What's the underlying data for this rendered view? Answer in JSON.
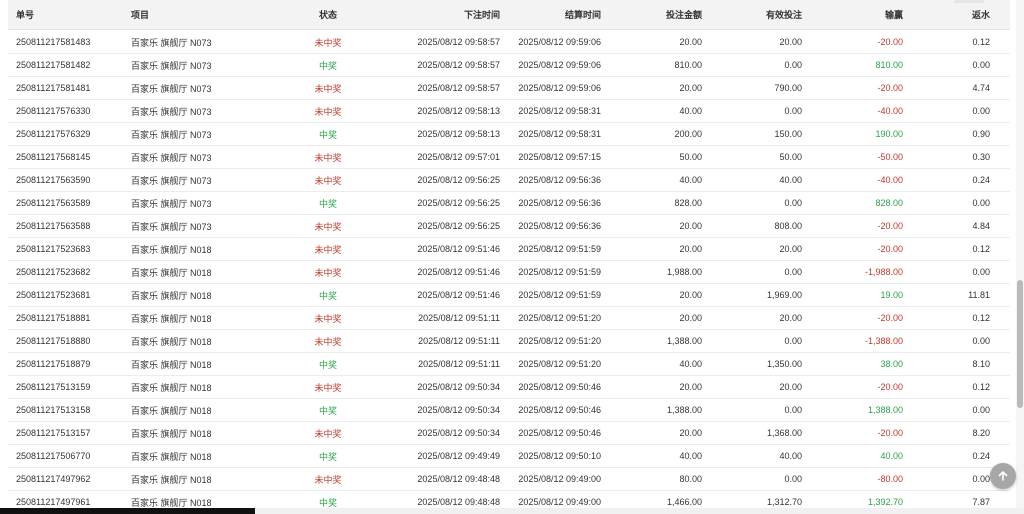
{
  "table": {
    "columns": {
      "id": "单号",
      "item": "项目",
      "status": "状态",
      "bet_time": "下注时间",
      "settle_time": "结算时间",
      "amount": "投注金额",
      "valid": "有效投注",
      "win_loss": "输赢",
      "rebate": "返水"
    },
    "rows": [
      {
        "id": "250811217581483",
        "item": "百家乐 旗舰厅 N073",
        "status": "未中奖",
        "status_type": "lose",
        "bet_time": "2025/08/12 09:58:57",
        "settle_time": "2025/08/12 09:59:06",
        "amount": "20.00",
        "valid": "20.00",
        "win_loss": "-20.00",
        "rebate": "0.12"
      },
      {
        "id": "250811217581482",
        "item": "百家乐 旗舰厅 N073",
        "status": "中奖",
        "status_type": "win",
        "bet_time": "2025/08/12 09:58:57",
        "settle_time": "2025/08/12 09:59:06",
        "amount": "810.00",
        "valid": "0.00",
        "win_loss": "810.00",
        "rebate": "0.00"
      },
      {
        "id": "250811217581481",
        "item": "百家乐 旗舰厅 N073",
        "status": "未中奖",
        "status_type": "lose",
        "bet_time": "2025/08/12 09:58:57",
        "settle_time": "2025/08/12 09:59:06",
        "amount": "20.00",
        "valid": "790.00",
        "win_loss": "-20.00",
        "rebate": "4.74"
      },
      {
        "id": "250811217576330",
        "item": "百家乐 旗舰厅 N073",
        "status": "未中奖",
        "status_type": "lose",
        "bet_time": "2025/08/12 09:58:13",
        "settle_time": "2025/08/12 09:58:31",
        "amount": "40.00",
        "valid": "0.00",
        "win_loss": "-40.00",
        "rebate": "0.00"
      },
      {
        "id": "250811217576329",
        "item": "百家乐 旗舰厅 N073",
        "status": "中奖",
        "status_type": "win",
        "bet_time": "2025/08/12 09:58:13",
        "settle_time": "2025/08/12 09:58:31",
        "amount": "200.00",
        "valid": "150.00",
        "win_loss": "190.00",
        "rebate": "0.90"
      },
      {
        "id": "250811217568145",
        "item": "百家乐 旗舰厅 N073",
        "status": "未中奖",
        "status_type": "lose",
        "bet_time": "2025/08/12 09:57:01",
        "settle_time": "2025/08/12 09:57:15",
        "amount": "50.00",
        "valid": "50.00",
        "win_loss": "-50.00",
        "rebate": "0.30"
      },
      {
        "id": "250811217563590",
        "item": "百家乐 旗舰厅 N073",
        "status": "未中奖",
        "status_type": "lose",
        "bet_time": "2025/08/12 09:56:25",
        "settle_time": "2025/08/12 09:56:36",
        "amount": "40.00",
        "valid": "40.00",
        "win_loss": "-40.00",
        "rebate": "0.24"
      },
      {
        "id": "250811217563589",
        "item": "百家乐 旗舰厅 N073",
        "status": "中奖",
        "status_type": "win",
        "bet_time": "2025/08/12 09:56:25",
        "settle_time": "2025/08/12 09:56:36",
        "amount": "828.00",
        "valid": "0.00",
        "win_loss": "828.00",
        "rebate": "0.00"
      },
      {
        "id": "250811217563588",
        "item": "百家乐 旗舰厅 N073",
        "status": "未中奖",
        "status_type": "lose",
        "bet_time": "2025/08/12 09:56:25",
        "settle_time": "2025/08/12 09:56:36",
        "amount": "20.00",
        "valid": "808.00",
        "win_loss": "-20.00",
        "rebate": "4.84"
      },
      {
        "id": "250811217523683",
        "item": "百家乐 旗舰厅 N018",
        "status": "未中奖",
        "status_type": "lose",
        "bet_time": "2025/08/12 09:51:46",
        "settle_time": "2025/08/12 09:51:59",
        "amount": "20.00",
        "valid": "20.00",
        "win_loss": "-20.00",
        "rebate": "0.12"
      },
      {
        "id": "250811217523682",
        "item": "百家乐 旗舰厅 N018",
        "status": "未中奖",
        "status_type": "lose",
        "bet_time": "2025/08/12 09:51:46",
        "settle_time": "2025/08/12 09:51:59",
        "amount": "1,988.00",
        "valid": "0.00",
        "win_loss": "-1,988.00",
        "rebate": "0.00"
      },
      {
        "id": "250811217523681",
        "item": "百家乐 旗舰厅 N018",
        "status": "中奖",
        "status_type": "win",
        "bet_time": "2025/08/12 09:51:46",
        "settle_time": "2025/08/12 09:51:59",
        "amount": "20.00",
        "valid": "1,969.00",
        "win_loss": "19.00",
        "rebate": "11.81"
      },
      {
        "id": "250811217518881",
        "item": "百家乐 旗舰厅 N018",
        "status": "未中奖",
        "status_type": "lose",
        "bet_time": "2025/08/12 09:51:11",
        "settle_time": "2025/08/12 09:51:20",
        "amount": "20.00",
        "valid": "20.00",
        "win_loss": "-20.00",
        "rebate": "0.12"
      },
      {
        "id": "250811217518880",
        "item": "百家乐 旗舰厅 N018",
        "status": "未中奖",
        "status_type": "lose",
        "bet_time": "2025/08/12 09:51:11",
        "settle_time": "2025/08/12 09:51:20",
        "amount": "1,388.00",
        "valid": "0.00",
        "win_loss": "-1,388.00",
        "rebate": "0.00"
      },
      {
        "id": "250811217518879",
        "item": "百家乐 旗舰厅 N018",
        "status": "中奖",
        "status_type": "win",
        "bet_time": "2025/08/12 09:51:11",
        "settle_time": "2025/08/12 09:51:20",
        "amount": "40.00",
        "valid": "1,350.00",
        "win_loss": "38.00",
        "rebate": "8.10"
      },
      {
        "id": "250811217513159",
        "item": "百家乐 旗舰厅 N018",
        "status": "未中奖",
        "status_type": "lose",
        "bet_time": "2025/08/12 09:50:34",
        "settle_time": "2025/08/12 09:50:46",
        "amount": "20.00",
        "valid": "20.00",
        "win_loss": "-20.00",
        "rebate": "0.12"
      },
      {
        "id": "250811217513158",
        "item": "百家乐 旗舰厅 N018",
        "status": "中奖",
        "status_type": "win",
        "bet_time": "2025/08/12 09:50:34",
        "settle_time": "2025/08/12 09:50:46",
        "amount": "1,388.00",
        "valid": "0.00",
        "win_loss": "1,388.00",
        "rebate": "0.00"
      },
      {
        "id": "250811217513157",
        "item": "百家乐 旗舰厅 N018",
        "status": "未中奖",
        "status_type": "lose",
        "bet_time": "2025/08/12 09:50:34",
        "settle_time": "2025/08/12 09:50:46",
        "amount": "20.00",
        "valid": "1,368.00",
        "win_loss": "-20.00",
        "rebate": "8.20"
      },
      {
        "id": "250811217506770",
        "item": "百家乐 旗舰厅 N018",
        "status": "中奖",
        "status_type": "win",
        "bet_time": "2025/08/12 09:49:49",
        "settle_time": "2025/08/12 09:50:10",
        "amount": "40.00",
        "valid": "40.00",
        "win_loss": "40.00",
        "rebate": "0.24"
      },
      {
        "id": "250811217497962",
        "item": "百家乐 旗舰厅 N018",
        "status": "未中奖",
        "status_type": "lose",
        "bet_time": "2025/08/12 09:48:48",
        "settle_time": "2025/08/12 09:49:00",
        "amount": "80.00",
        "valid": "0.00",
        "win_loss": "-80.00",
        "rebate": "0.00"
      },
      {
        "id": "250811217497961",
        "item": "百家乐 旗舰厅 N018",
        "status": "中奖",
        "status_type": "win",
        "bet_time": "2025/08/12 09:48:48",
        "settle_time": "2025/08/12 09:49:00",
        "amount": "1,466.00",
        "valid": "1,312.70",
        "win_loss": "1,392.70",
        "rebate": "7.87"
      }
    ]
  },
  "colors": {
    "lose": "#c0392b",
    "win": "#27a348",
    "header_bg": "#f3f3f3"
  },
  "icons": {
    "back_to_top": "arrow-up-icon"
  }
}
